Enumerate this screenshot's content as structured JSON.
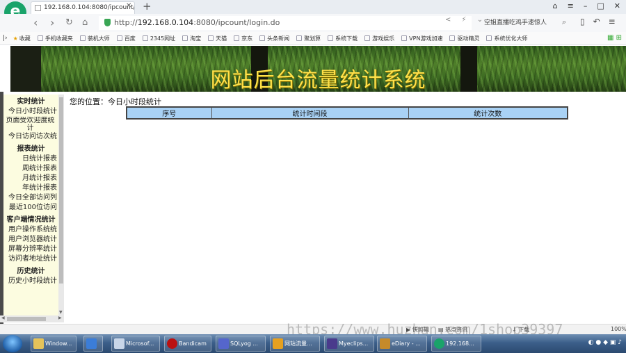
{
  "browser": {
    "tab_title": "192.168.0.104:8080/ipcount/",
    "url_prefix": "http://",
    "url_host": "192.168.0.104",
    "url_path": ":8080/ipcount/login.do",
    "search_text": "空姐直播吃鸡手速惊人",
    "logo_letter": "e"
  },
  "bookmarks": [
    "收藏",
    "手机收藏夹",
    "装机大师",
    "百度",
    "2345网址",
    "淘宝",
    "天猫",
    "京东",
    "头条新闻",
    "聚划算",
    "系统下载",
    "游戏娱乐",
    "VPN游戏加速",
    "驱动精灵",
    "系统优化大师"
  ],
  "banner": {
    "title": "网站后台流量统计系统"
  },
  "sidebar": {
    "sections": [
      {
        "title": "实时统计",
        "items": [
          "今日小时段统计",
          "页面受欢迎度统计",
          "今日访问访次统"
        ]
      },
      {
        "title": "报表统计",
        "items": [
          "日统计报表",
          "周统计报表",
          "月统计报表",
          "年统计报表",
          "今日全部访问列",
          "最近100位访问"
        ]
      },
      {
        "title": "客户端情况统计",
        "items": [
          "用户操作系统统",
          "用户浏览器统计",
          "屏幕分辨率统计",
          "访问者地址统计"
        ]
      },
      {
        "title": "历史统计",
        "items": [
          "历史小时段统计"
        ]
      }
    ]
  },
  "main": {
    "breadcrumb": "您的位置：今日小时段统计",
    "table_headers": [
      "序号",
      "统计时间段",
      "统计次数"
    ]
  },
  "statusbar": {
    "fast_clip": "快剪辑",
    "news": "热点资讯",
    "download": "下载",
    "zoom": "100%"
  },
  "taskbar": {
    "items": [
      {
        "label": "Window...",
        "color": "#e5c35a"
      },
      {
        "label": "",
        "color": "#3b7dd8"
      },
      {
        "label": "Microsof...",
        "color": "#c9d6e8"
      },
      {
        "label": "Bandicam",
        "color": "#b11"
      },
      {
        "label": "SQLyog ...",
        "color": "#5566cc"
      },
      {
        "label": "网站流量...",
        "color": "#e6a020"
      },
      {
        "label": "Myeclips...",
        "color": "#4a3b8c"
      },
      {
        "label": "eDiary - ...",
        "color": "#c58a2a"
      },
      {
        "label": "192.168...",
        "color": "#1aa36a"
      }
    ],
    "time": "..."
  },
  "watermark": "https://www.huzhan.com/1shop39397"
}
